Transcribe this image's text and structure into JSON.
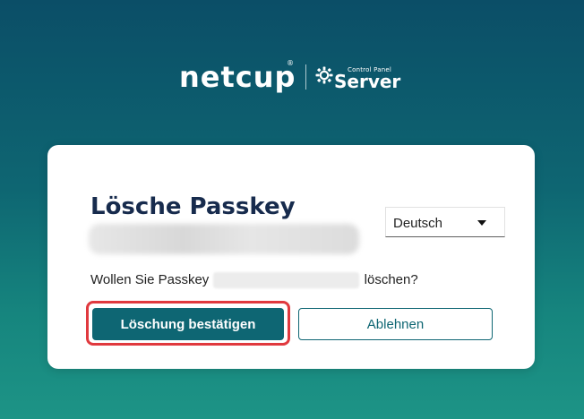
{
  "brand": {
    "logo_text": "netcup",
    "registered_mark": "®",
    "product_small": "Control Panel",
    "product_large": "Server"
  },
  "dialog": {
    "title": "Lösche Passkey",
    "question_prefix": "Wollen Sie Passkey",
    "question_suffix": "löschen?",
    "confirm_label": "Löschung bestätigen",
    "decline_label": "Ablehnen"
  },
  "language": {
    "selected": "Deutsch"
  },
  "colors": {
    "primary": "#0e6673",
    "title": "#172b4d",
    "focus_ring": "#e0393e"
  }
}
